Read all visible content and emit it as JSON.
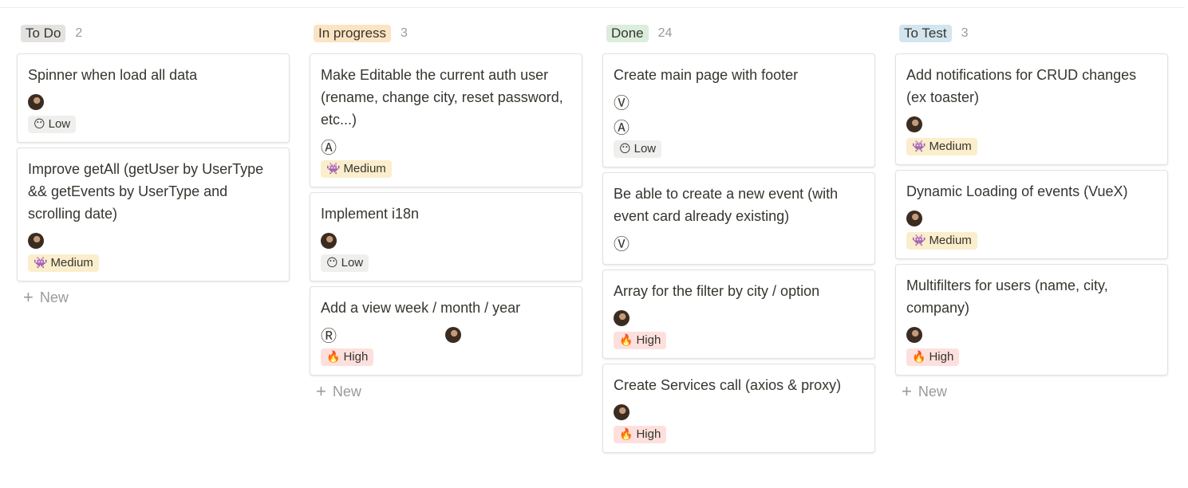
{
  "colors": {
    "todo": "#e3e2e0",
    "inprogress": "#fbe4c3",
    "done": "#dbeddb",
    "totest": "#d3e5ef",
    "low": "#efefed",
    "medium": "#fbeecc",
    "high": "#fde0dd"
  },
  "priority_icons": {
    "Low": "neutral-face-emoji",
    "Medium": "alien-monster-emoji",
    "High": "fire-emoji"
  },
  "columns": [
    {
      "title": "To Do",
      "count": "2",
      "new_label": "New",
      "cards": [
        {
          "title": "Spinner when load all data",
          "avatar": true,
          "priority": "Low"
        },
        {
          "title": "Improve getAll (getUser by UserType && getEvents by UserType and scrolling date)",
          "avatar": true,
          "priority": "Medium"
        }
      ]
    },
    {
      "title": "In progress",
      "count": "3",
      "new_label": "New",
      "cards": [
        {
          "title": "Make Editable the current auth user (rename, change city, reset password, etc...)",
          "letters": [
            "A"
          ],
          "priority": "Medium"
        },
        {
          "title": "Implement i18n",
          "avatar": true,
          "priority": "Low"
        },
        {
          "title": "Add a view week / month / year",
          "letters": [
            "R"
          ],
          "priority": "High"
        }
      ]
    },
    {
      "title": "Done",
      "count": "24",
      "cards": [
        {
          "title": "Create main page with footer",
          "letters": [
            "V",
            "A"
          ],
          "priority": "Low"
        },
        {
          "title": "Be able to create a new event (with event card already existing)",
          "letters": [
            "V"
          ]
        },
        {
          "title": "Array for the filter by city / option",
          "avatar": true,
          "priority": "High"
        },
        {
          "title": "Create Services call (axios & proxy)",
          "avatar": true,
          "priority": "High"
        }
      ]
    },
    {
      "title": "To Test",
      "count": "3",
      "new_label": "New",
      "cards": [
        {
          "title": "Add notifications for CRUD changes (ex toaster)",
          "avatar": true,
          "priority": "Medium"
        },
        {
          "title": "Dynamic Loading of events (VueX)",
          "avatar": true,
          "priority": "Medium"
        },
        {
          "title": "Multifilters for users (name, city, company)",
          "avatar": true,
          "priority": "High"
        }
      ]
    }
  ]
}
